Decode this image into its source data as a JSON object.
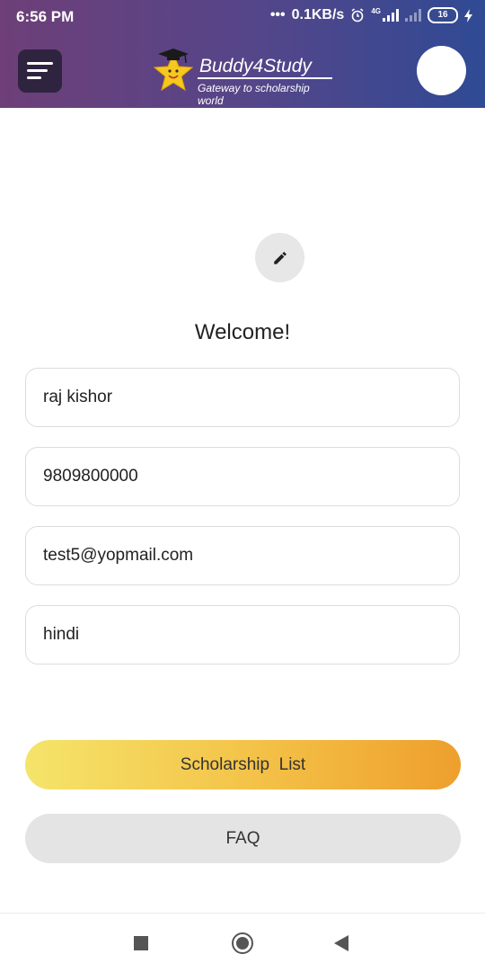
{
  "status_bar": {
    "time": "6:56 PM",
    "net_speed": "0.1KB/s",
    "network": "4G",
    "battery": "16"
  },
  "header": {
    "brand": "Buddy4Study",
    "tagline": "Gateway to scholarship world"
  },
  "profile": {
    "welcome": "Welcome!"
  },
  "form": {
    "name": "raj kishor",
    "phone": "9809800000",
    "email": "test5@yopmail.com",
    "language": "hindi"
  },
  "buttons": {
    "scholarship_list": "Scholarship  List",
    "faq": "FAQ"
  },
  "colors": {
    "header_start": "#6e3f78",
    "header_end": "#2f4a94",
    "button_gradient_start": "#f5e46a",
    "button_gradient_end": "#ee9f2c"
  }
}
